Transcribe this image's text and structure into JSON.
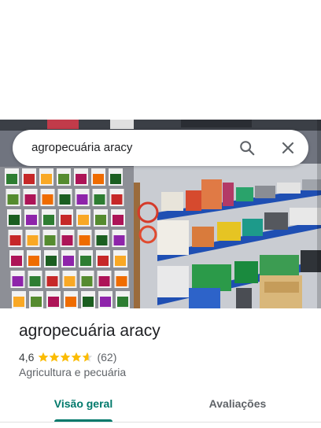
{
  "search": {
    "query": "agropecuária aracy",
    "search_icon": "search-icon",
    "close_icon": "close-icon"
  },
  "photo": {
    "description_icon": "store-photo"
  },
  "place": {
    "title": "agropecuária aracy",
    "rating": "4,6",
    "stars": 4.6,
    "review_count": "(62)",
    "category": "Agricultura e pecuária"
  },
  "tabs": [
    {
      "label": "Visão geral",
      "selected": true
    },
    {
      "label": "Avaliações",
      "selected": false
    }
  ],
  "colors": {
    "accent": "#00796b",
    "star": "#fbbc04",
    "star_empty": "#dadce0"
  }
}
